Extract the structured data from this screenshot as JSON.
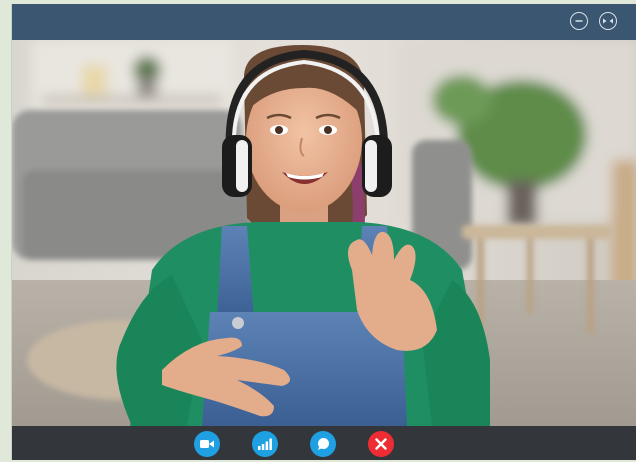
{
  "window": {
    "titlebar_color": "#3b5670",
    "controls_bar_color": "#33373c"
  },
  "title_buttons": [
    {
      "icon": "minimize-icon"
    },
    {
      "icon": "restore-icon"
    }
  ],
  "call_controls": [
    {
      "icon": "video-camera-icon",
      "color": "#1fa0e3"
    },
    {
      "icon": "signal-bars-icon",
      "color": "#1fa0e3"
    },
    {
      "icon": "chat-bubble-icon",
      "color": "#1fa0e3"
    },
    {
      "icon": "end-call-x-icon",
      "color": "#ee2c33"
    }
  ]
}
